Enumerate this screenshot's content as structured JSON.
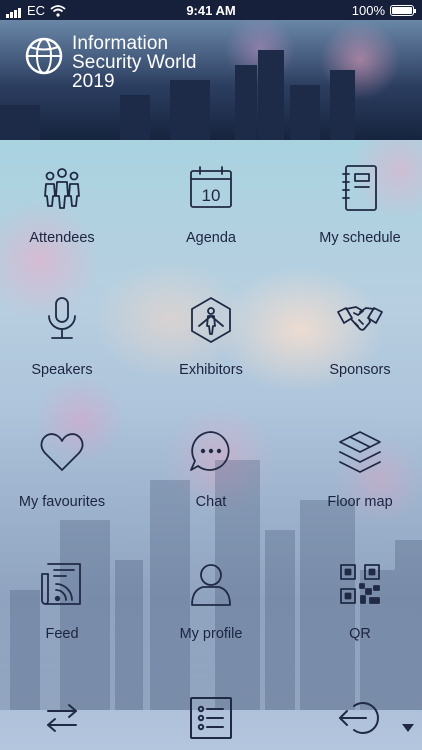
{
  "status_bar": {
    "carrier": "EC",
    "time": "9:41 AM",
    "battery": "100%"
  },
  "header": {
    "logo_line1": "Information",
    "logo_line2": "Security World",
    "logo_line3": "2019"
  },
  "menu": {
    "attendees": "Attendees",
    "agenda": "Agenda",
    "agenda_day": "10",
    "my_schedule": "My schedule",
    "speakers": "Speakers",
    "exhibitors": "Exhibitors",
    "sponsors": "Sponsors",
    "my_favourites": "My favourites",
    "chat": "Chat",
    "floor_map": "Floor map",
    "feed": "Feed",
    "my_profile": "My profile",
    "qr": "QR"
  },
  "bottom_bar": {
    "icons": [
      "switch-arrows-icon",
      "list-icon",
      "logout-icon",
      "caret-down-icon"
    ]
  },
  "colors": {
    "icon": "#202a45",
    "header_bg": "#16243e",
    "status_bg": "#16203a"
  }
}
